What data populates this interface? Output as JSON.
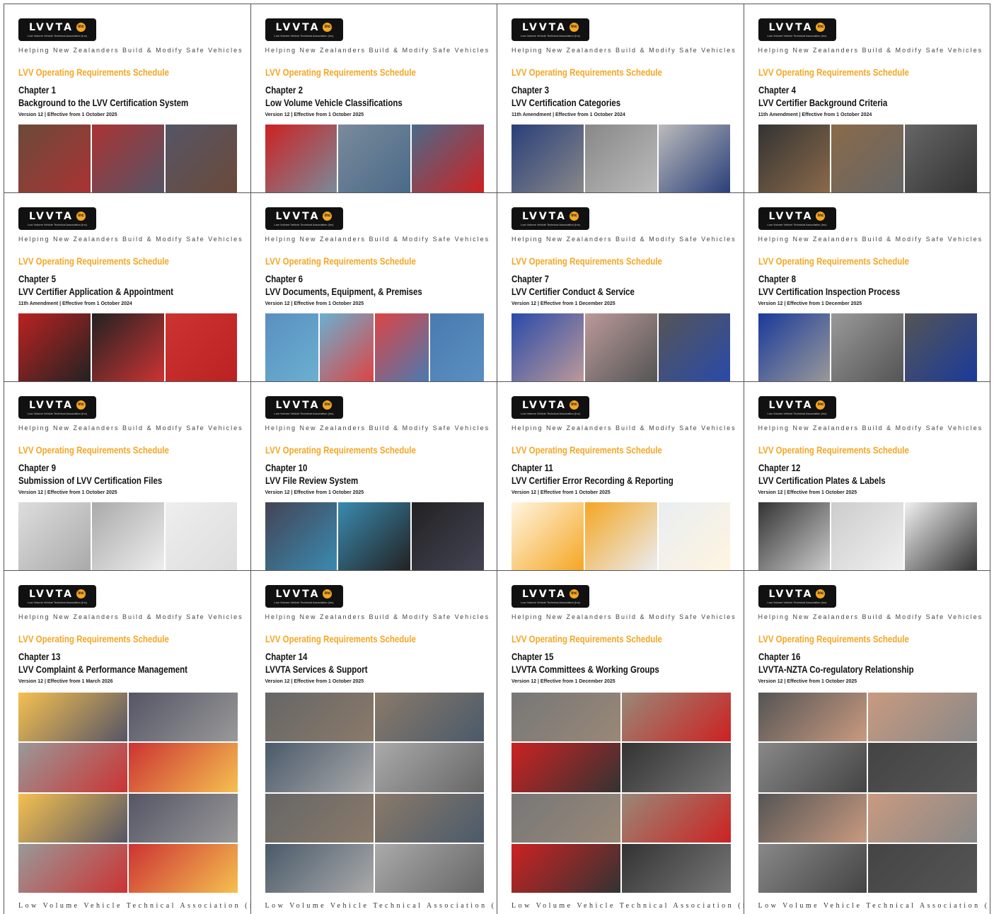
{
  "brand": {
    "logo_letters": "LVVTA",
    "logo_badge": "inc",
    "logo_subtitle": "Low Volume Vehicle Technical Association (Inc)",
    "tagline": "Helping New Zealanders Build & Modify Safe Vehicles",
    "series": "LVV Operating Requirements Schedule",
    "footer": "Low Volume Vehicle Technical Association (inc)",
    "accent_color": "#f5a623"
  },
  "covers": [
    {
      "chapter": "Chapter 1",
      "title": "Background to the LVV Certification System",
      "version": "Version 12 | Effective from 1 October 2025",
      "colors": [
        "#6b4a3a",
        "#a33",
        "#556"
      ]
    },
    {
      "chapter": "Chapter 2",
      "title": "Low Volume Vehicle Classifications",
      "version": "Version 12 | Effective from 1 October 2025",
      "colors": [
        "#c22",
        "#7a8a9a",
        "#4a6a8a"
      ]
    },
    {
      "chapter": "Chapter 3",
      "title": "LVV Certification Categories",
      "version": "11th Amendment | Effective from 1 October 2024",
      "colors": [
        "#2a3f7a",
        "#888",
        "#bbb"
      ]
    },
    {
      "chapter": "Chapter 4",
      "title": "LVV Certifier Background Criteria",
      "version": "11th Amendment | Effective from 1 October 2024",
      "colors": [
        "#333",
        "#8a6a4a",
        "#666"
      ]
    },
    {
      "chapter": "Chapter 5",
      "title": "LVV Certifier Application & Appointment",
      "version": "11th Amendment | Effective from 1 October 2024",
      "colors": [
        "#b22",
        "#222",
        "#c33"
      ]
    },
    {
      "chapter": "Chapter 6",
      "title": "LVV Documents, Equipment, & Premises",
      "version": "Version 12 | Effective from 1 October 2025",
      "colors": [
        "#5a8fc0",
        "#6ab0d0",
        "#d44",
        "#4a7ab0"
      ]
    },
    {
      "chapter": "Chapter 7",
      "title": "LVV Certifier Conduct & Service",
      "version": "Version 12 | Effective from 1 December 2025",
      "colors": [
        "#2a4aaa",
        "#b99",
        "#555"
      ]
    },
    {
      "chapter": "Chapter 8",
      "title": "LVV Certification Inspection Process",
      "version": "Version 12 | Effective from 1 December 2025",
      "colors": [
        "#1a3a9a",
        "#999",
        "#555"
      ]
    },
    {
      "chapter": "Chapter 9",
      "title": "Submission of LVV Certification Files",
      "version": "Version 12 | Effective from 1 October 2025",
      "colors": [
        "#ddd",
        "#aaa",
        "#eee"
      ]
    },
    {
      "chapter": "Chapter 10",
      "title": "LVV File Review System",
      "version": "Version 12 | Effective from 1 October 2025",
      "colors": [
        "#445",
        "#3a8ab0",
        "#222"
      ]
    },
    {
      "chapter": "Chapter 11",
      "title": "LVV Certifier Error Recording & Reporting",
      "version": "Version 12 | Effective from 1 October 2025",
      "colors": [
        "#fff5e0",
        "#f5a623",
        "#e9edf2"
      ]
    },
    {
      "chapter": "Chapter 12",
      "title": "LVV Certification Plates & Labels",
      "version": "Version 12 | Effective from 1 October 2025",
      "colors": [
        "#333",
        "#ccc",
        "#f0f0f0"
      ]
    },
    {
      "chapter": "Chapter 13",
      "title": "LVV Complaint & Performance Management",
      "version": "Version 12 | Effective from 1 March 2026",
      "colors": [
        "#f5c050",
        "#556",
        "#999",
        "#c33"
      ]
    },
    {
      "chapter": "Chapter 14",
      "title": "LVVTA Services & Support",
      "version": "Version 12 | Effective from 1 October 2025",
      "colors": [
        "#666",
        "#8a7a6a",
        "#4a5a6a",
        "#aaa"
      ]
    },
    {
      "chapter": "Chapter 15",
      "title": "LVVTA Committees & Working Groups",
      "version": "Version 12 | Effective from 1 December 2025",
      "colors": [
        "#777",
        "#998877",
        "#c22",
        "#333"
      ]
    },
    {
      "chapter": "Chapter 16",
      "title": "LVVTA-NZTA Co-regulatory Relationship",
      "version": "Version 12 | Effective from 1 October 2025",
      "colors": [
        "#555",
        "#c99a80",
        "#888",
        "#444"
      ]
    }
  ]
}
